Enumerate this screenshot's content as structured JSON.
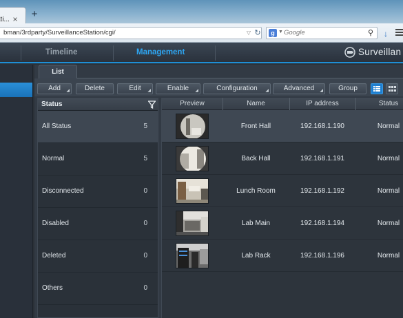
{
  "browser": {
    "tab_title": "ati...",
    "tab_close": "×",
    "new_tab": "+",
    "url": "bman/3rdparty/SurveillanceStation/cgi/",
    "search_engine_letter": "g",
    "search_placeholder": "Google"
  },
  "nav": {
    "timeline": "Timeline",
    "management": "Management",
    "logo": "Surveillan"
  },
  "tabs": {
    "list": "List"
  },
  "toolbar": {
    "buttons": [
      {
        "label": "Add",
        "has_menu": true
      },
      {
        "label": "Delete",
        "has_menu": false
      },
      {
        "label": "Edit",
        "has_menu": true
      },
      {
        "label": "Enable",
        "has_menu": true
      },
      {
        "label": "Configuration",
        "has_menu": true
      },
      {
        "label": "Advanced",
        "has_menu": true
      },
      {
        "label": "Group",
        "has_menu": false
      }
    ],
    "active_view": "list"
  },
  "status_panel": {
    "title": "Status",
    "items": [
      {
        "label": "All Status",
        "count": "5",
        "selected": true
      },
      {
        "label": "Normal",
        "count": "5",
        "selected": false
      },
      {
        "label": "Disconnected",
        "count": "0",
        "selected": false
      },
      {
        "label": "Disabled",
        "count": "0",
        "selected": false
      },
      {
        "label": "Deleted",
        "count": "0",
        "selected": false
      },
      {
        "label": "Others",
        "count": "0",
        "selected": false
      }
    ]
  },
  "camera_table": {
    "columns": {
      "preview": "Preview",
      "name": "Name",
      "ip": "IP address",
      "status": "Status"
    },
    "rows": [
      {
        "name": "Front Hall",
        "ip": "192.168.1.190",
        "status": "Normal",
        "selected": true
      },
      {
        "name": "Back Hall",
        "ip": "192.168.1.191",
        "status": "Normal",
        "selected": false
      },
      {
        "name": "Lunch Room",
        "ip": "192.168.1.192",
        "status": "Normal",
        "selected": false
      },
      {
        "name": "Lab Main",
        "ip": "192.168.1.194",
        "status": "Normal",
        "selected": false
      },
      {
        "name": "Lab Rack",
        "ip": "192.168.1.196",
        "status": "Normal",
        "selected": false
      }
    ]
  },
  "colors": {
    "accent": "#2ea6f2",
    "selection": "#1e7fd0"
  }
}
